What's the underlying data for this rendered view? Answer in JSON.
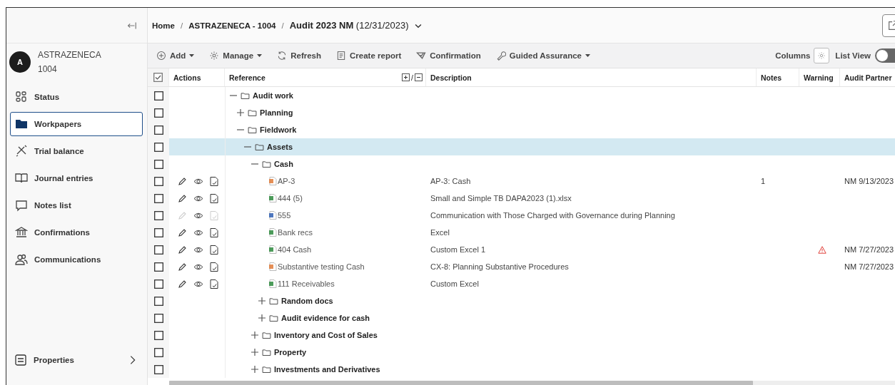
{
  "sidebar": {
    "account": {
      "avatar": "A",
      "name": "ASTRAZENECA",
      "number": "1004"
    },
    "items": [
      {
        "label": "Status",
        "selected": false
      },
      {
        "label": "Workpapers",
        "selected": true
      },
      {
        "label": "Trial balance",
        "selected": false
      },
      {
        "label": "Journal entries",
        "selected": false
      },
      {
        "label": "Notes list",
        "selected": false
      },
      {
        "label": "Confirmations",
        "selected": false
      },
      {
        "label": "Communications",
        "selected": false
      }
    ],
    "footer": {
      "label": "Properties"
    }
  },
  "header": {
    "breadcrumb": [
      {
        "kind": "link",
        "label": "Home"
      },
      {
        "kind": "separator",
        "label": "/"
      },
      {
        "kind": "crumb",
        "label": "ASTRAZENECA - 1004"
      },
      {
        "kind": "separator",
        "label": "/"
      },
      {
        "kind": "current",
        "label": "**Audit 2023 NM** (12/31/2023)"
      }
    ]
  },
  "toolbar": {
    "actions": [
      {
        "label": "Add",
        "dropdown": true
      },
      {
        "label": "Manage",
        "dropdown": true
      },
      {
        "label": "Refresh",
        "dropdown": false
      },
      {
        "label": "Create report",
        "dropdown": false
      },
      {
        "label": "Confirmation",
        "dropdown": false
      },
      {
        "label": "Guided Assurance",
        "dropdown": true
      }
    ],
    "columns_label": "Columns",
    "list_view": {
      "label": "List View",
      "on": false
    }
  },
  "table": {
    "select_all_checked": true,
    "columns": [
      "Actions",
      "Reference",
      "Description",
      "Notes",
      "Warning",
      "Audit Partner"
    ],
    "reference_toggle_separator": "/",
    "tree": [
      {
        "kind": "folder",
        "label": "Audit work",
        "expanded": true,
        "selected": false,
        "checked": false,
        "children": [
          {
            "kind": "folder",
            "label": "Planning",
            "expanded": false,
            "selected": false,
            "checked": false
          },
          {
            "kind": "folder",
            "label": "Fieldwork",
            "expanded": true,
            "selected": false,
            "checked": false,
            "children": [
              {
                "kind": "folder",
                "label": "Assets",
                "expanded": true,
                "selected": true,
                "checked": false,
                "children": [
                  {
                    "kind": "folder",
                    "label": "Cash",
                    "expanded": true,
                    "selected": false,
                    "checked": false,
                    "children": [
                      {
                        "kind": "pdf",
                        "label": "AP-3",
                        "selected": false,
                        "checked": false,
                        "actions_disabled": false,
                        "description": "AP-3: Cash",
                        "notes": "1",
                        "warning": false,
                        "audit_partner": "NM 9/13/2023"
                      },
                      {
                        "kind": "excel",
                        "label": "444 (5)",
                        "selected": false,
                        "checked": false,
                        "actions_disabled": false,
                        "description": "Small and Simple TB DAPA2023 (1).xlsx",
                        "warning": false
                      },
                      {
                        "kind": "word",
                        "label": "555",
                        "selected": false,
                        "checked": false,
                        "actions_disabled": true,
                        "description": "Communication with Those Charged with Governance during Planning",
                        "warning": false
                      },
                      {
                        "kind": "excel",
                        "label": "Bank recs",
                        "selected": false,
                        "checked": false,
                        "actions_disabled": false,
                        "description": "Excel",
                        "warning": false
                      },
                      {
                        "kind": "excel",
                        "label": "404 Cash",
                        "selected": false,
                        "checked": false,
                        "actions_disabled": false,
                        "description": "Custom Excel 1",
                        "warning": true,
                        "audit_partner": "NM 7/27/2023"
                      },
                      {
                        "kind": "pdf",
                        "label": "Substantive testing Cash",
                        "selected": false,
                        "checked": false,
                        "actions_disabled": false,
                        "description": "CX-8: Planning Substantive Procedures",
                        "warning": false,
                        "audit_partner": "NM 7/27/2023"
                      },
                      {
                        "kind": "excel",
                        "label": "111 Receivables",
                        "selected": false,
                        "checked": false,
                        "actions_disabled": false,
                        "description": "Custom Excel",
                        "warning": false
                      },
                      {
                        "kind": "folder",
                        "label": "Random docs",
                        "expanded": false,
                        "selected": false,
                        "checked": false
                      },
                      {
                        "kind": "folder",
                        "label": "Audit evidence for cash",
                        "expanded": false,
                        "selected": false,
                        "checked": false
                      }
                    ]
                  },
                  {
                    "kind": "folder",
                    "label": "Inventory and Cost of Sales",
                    "expanded": false,
                    "selected": false,
                    "checked": false
                  },
                  {
                    "kind": "folder",
                    "label": "Property",
                    "expanded": false,
                    "selected": false,
                    "checked": false
                  },
                  {
                    "kind": "folder",
                    "label": "Investments and Derivatives",
                    "expanded": false,
                    "selected": false,
                    "checked": false
                  }
                ]
              }
            ]
          }
        ]
      }
    ]
  }
}
